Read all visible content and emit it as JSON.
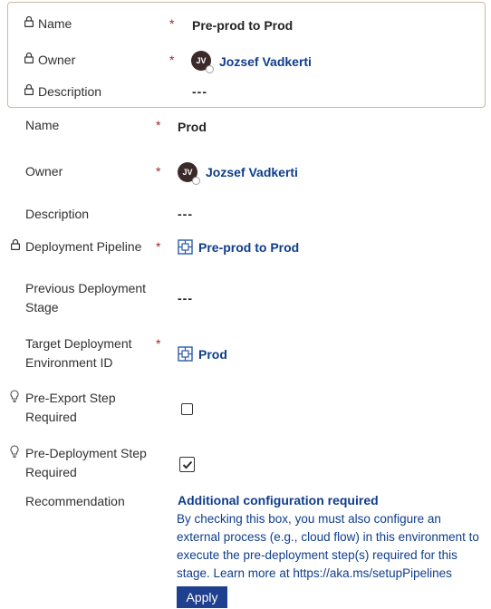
{
  "parent_record": {
    "name_label": "Name",
    "name_value": "Pre-prod to Prod",
    "owner_label": "Owner",
    "owner_initials": "JV",
    "owner_value": "Jozsef Vadkerti",
    "description_label": "Description",
    "description_value": "---"
  },
  "form": {
    "required_marker": "*",
    "name_label": "Name",
    "name_value": "Prod",
    "owner_label": "Owner",
    "owner_initials": "JV",
    "owner_value": "Jozsef Vadkerti",
    "description_label": "Description",
    "description_value": "---",
    "pipeline_label": "Deployment Pipeline",
    "pipeline_value": "Pre-prod to Prod",
    "prev_stage_label_line1": "Previous Deployment",
    "prev_stage_label_line2": "Stage",
    "prev_stage_value": "---",
    "target_env_label_line1": "Target Deployment",
    "target_env_label_line2": "Environment ID",
    "target_env_value": "Prod",
    "pre_export_label_line1": "Pre-Export Step",
    "pre_export_label_line2": "Required",
    "pre_export_checked": false,
    "pre_deploy_label_line1": "Pre-Deployment Step",
    "pre_deploy_label_line2": "Required",
    "pre_deploy_checked": true,
    "recommendation_label": "Recommendation"
  },
  "recommendation": {
    "title": "Additional configuration required",
    "line1": "By checking this box, you must also configure an",
    "line2": "external process (e.g., cloud flow) in this environment to",
    "line3": "execute the pre-deployment step(s) required for this",
    "line4": "stage. Learn more at https://aka.ms/setupPipelines",
    "button_label": "Apply"
  },
  "colors": {
    "link": "#0f3d8c",
    "required": "#a4262c",
    "apply_button": "#1f3f8f",
    "box_border": "#c8b9a5"
  },
  "icons": [
    "lock-icon",
    "lightbulb-icon",
    "entity-icon",
    "avatar",
    "checkbox"
  ]
}
